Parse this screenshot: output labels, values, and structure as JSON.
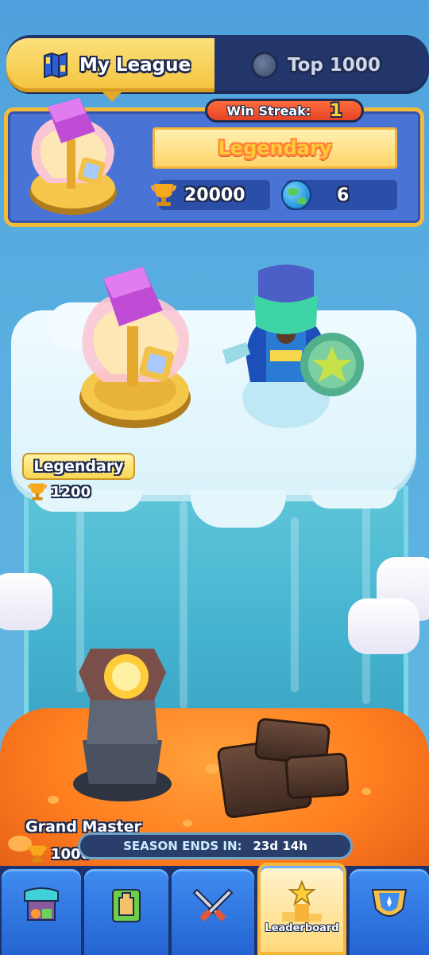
{
  "tabs": {
    "my_league": "My League",
    "top": "Top 1000",
    "active": "my_league"
  },
  "league_panel": {
    "win_streak_label": "Win Streak:",
    "win_streak_value": "1",
    "league_name": "Legendary",
    "trophies": "20000",
    "global_rank": "6"
  },
  "map": {
    "upper_league": {
      "name": "Legendary",
      "required_trophies": "1200"
    },
    "lower_league": {
      "name": "Grand Master",
      "required_trophies": "1000"
    }
  },
  "season": {
    "label": "SEASON ENDS IN:",
    "time_left": "23d 14h"
  },
  "bottom_nav": {
    "items": [
      {
        "id": "shop",
        "icon": "shop-stall-icon"
      },
      {
        "id": "cards",
        "icon": "tower-card-icon"
      },
      {
        "id": "battle",
        "icon": "crossed-swords-icon"
      },
      {
        "id": "leaderboard",
        "icon": "podium-star-icon",
        "label": "Leaderboard"
      },
      {
        "id": "clan",
        "icon": "clan-shield-icon"
      }
    ],
    "active": "leaderboard"
  },
  "colors": {
    "tab_active": "#f4c33d",
    "panel_bg": "#4a73d6",
    "panel_border": "#f6b93a",
    "nav_blue": "#2464d2",
    "lava": "#ff7d1f",
    "ice": "#44b3cf"
  }
}
